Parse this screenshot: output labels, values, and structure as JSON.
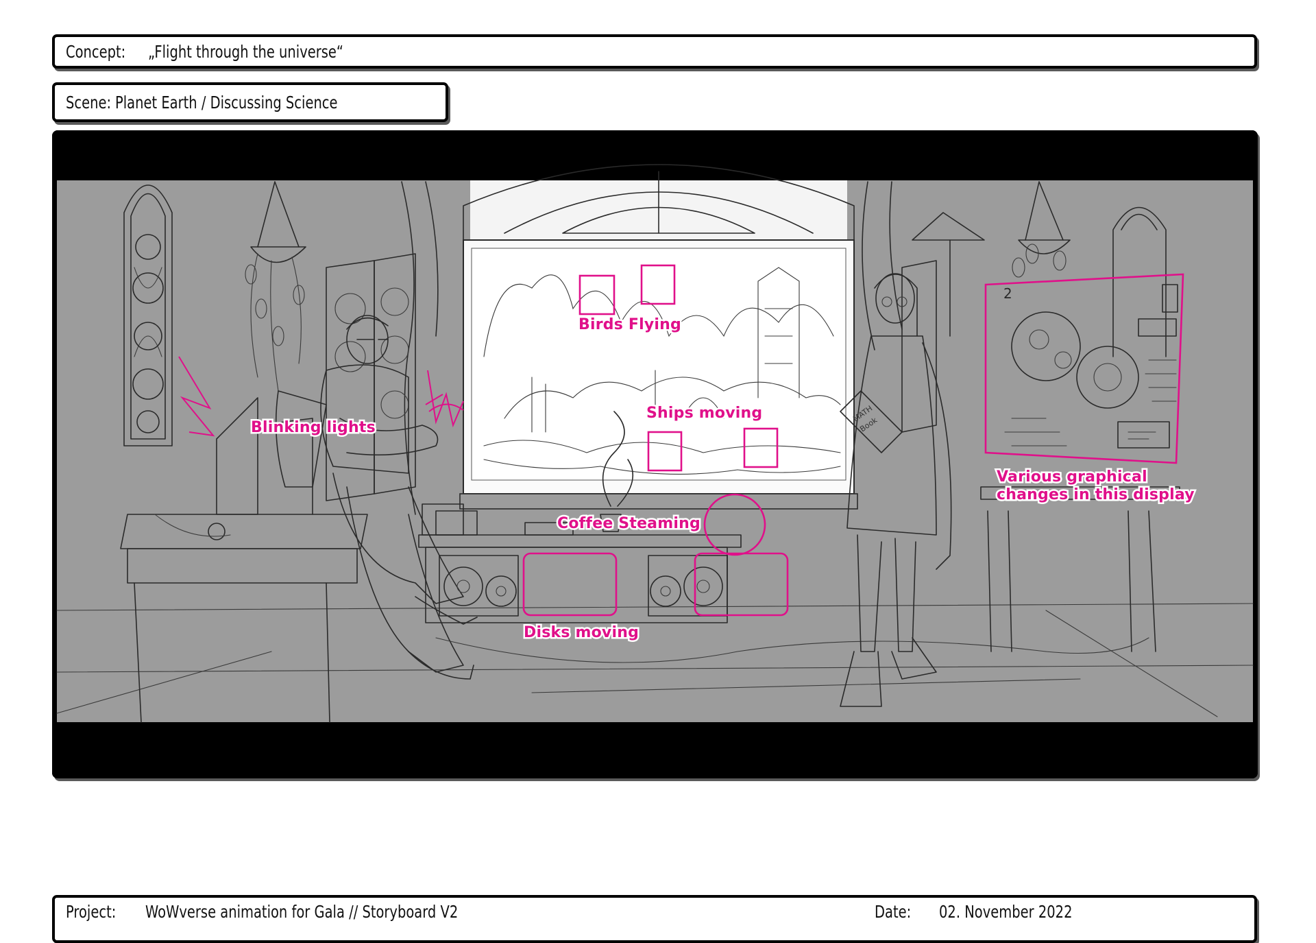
{
  "concept": {
    "label": "Concept:",
    "value": "„Flight through the universe“"
  },
  "scene": {
    "label": "Scene:",
    "value": "Planet Earth / Discussing Science"
  },
  "panel": {
    "annotations": {
      "birds": "Birds Flying",
      "blinking": "Blinking lights",
      "ships": "Ships moving",
      "coffee": "Coffee Steaming",
      "disks": "Disks moving",
      "display_line1": "Various graphical",
      "display_line2": "changes in this display"
    },
    "book_text_line1": "MATH",
    "book_text_line2": "Book",
    "board_number": "2",
    "annotation_color": "#e0108a"
  },
  "footer": {
    "project_label": "Project:",
    "project_value": "WoWverse animation for Gala // Storyboard V2",
    "date_label": "Date:",
    "date_value": "02. November 2022"
  }
}
